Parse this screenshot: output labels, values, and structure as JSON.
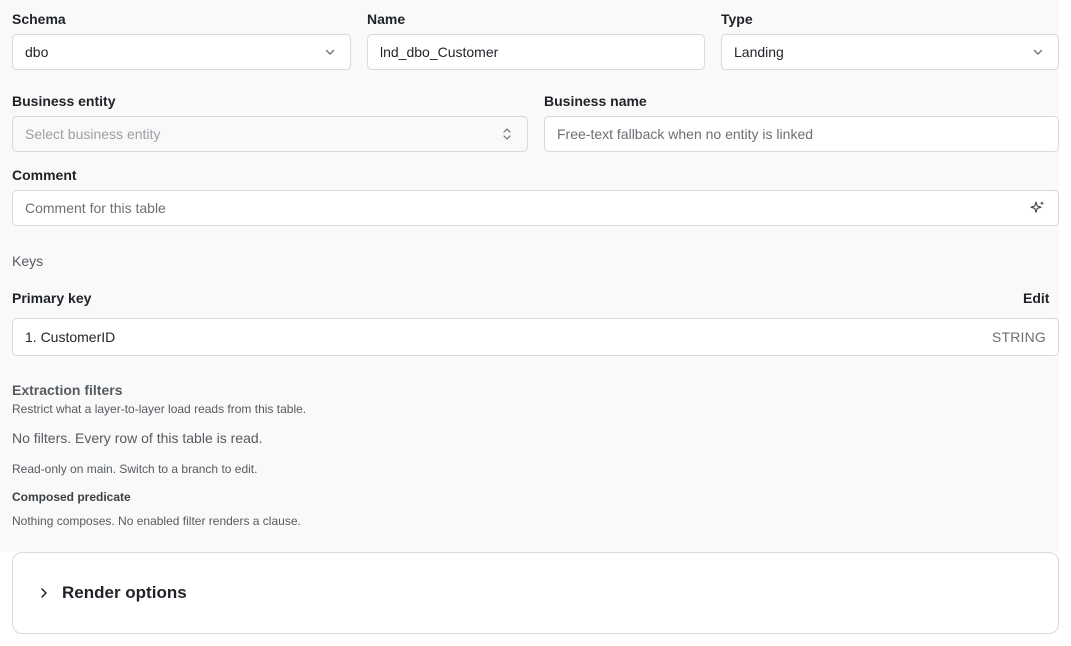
{
  "schema": {
    "label": "Schema",
    "value": "dbo",
    "icon": "chevron-down-icon"
  },
  "name": {
    "label": "Name",
    "value": "lnd_dbo_Customer"
  },
  "type": {
    "label": "Type",
    "value": "Landing",
    "icon": "chevron-down-icon"
  },
  "business_entity": {
    "label": "Business entity",
    "placeholder": "Select business entity",
    "icon": "chevron-updown-icon"
  },
  "business_name": {
    "label": "Business name",
    "placeholder": "Free-text fallback when no entity is linked"
  },
  "comment": {
    "label": "Comment",
    "placeholder": "Comment for this table",
    "icon": "sparkle-icon"
  },
  "keys": {
    "section_title": "Keys",
    "primary_key_label": "Primary key",
    "edit_label": "Edit",
    "items": [
      {
        "name": "1. CustomerID",
        "type": "STRING"
      }
    ]
  },
  "extraction_filters": {
    "title": "Extraction filters",
    "subtitle": "Restrict what a layer-to-layer load reads from this table.",
    "empty_text": "No filters. Every row of this table is read.",
    "readonly_note": "Read-only on main. Switch to a branch to edit.",
    "composed_predicate_label": "Composed predicate",
    "composed_predicate_text": "Nothing composes. No enabled filter renders a clause."
  },
  "render_options": {
    "title": "Render options",
    "icon": "chevron-right-icon"
  },
  "colors": {
    "panel_bg": "#f9f9f9",
    "border": "#d7d9dc",
    "text": "#1f2328",
    "muted": "#555b61"
  }
}
